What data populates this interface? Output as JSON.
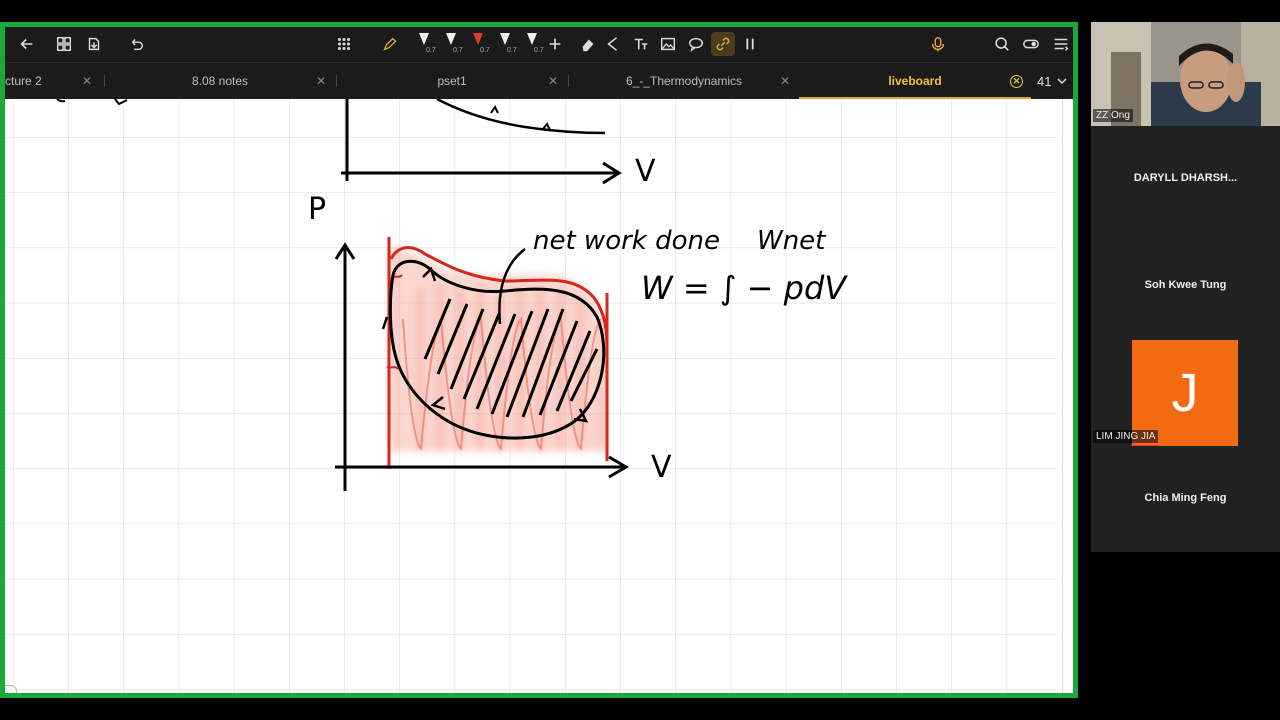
{
  "toolbar": {
    "back": "back-arrow-icon",
    "pens": [
      "0.7",
      "0.7",
      "0.7",
      "0.7",
      "0.7"
    ],
    "icons": [
      "back-arrow-icon",
      "grid-icon",
      "export-icon",
      "undo-icon",
      "apps-grid-icon",
      "pencil-icon",
      "plus-icon",
      "eraser-icon",
      "lasso-icon",
      "text-icon",
      "image-icon",
      "comment-icon",
      "link-icon",
      "pause-icon",
      "microphone-icon",
      "search-icon",
      "toggle-icon",
      "menu-icon"
    ]
  },
  "tabs": [
    {
      "label": "cture 2"
    },
    {
      "label": "8.08 notes"
    },
    {
      "label": "pset1"
    },
    {
      "label": "6_-_Thermodynamics"
    },
    {
      "label": "liveboard",
      "active": true
    }
  ],
  "page_count": "41",
  "whiteboard": {
    "handwriting": {
      "axis_top_v": "V",
      "axis_p": "P",
      "axis_bottom_v": "V",
      "annotation_1": "net work done",
      "annotation_2": "Wnet",
      "equation": "W = ∫ − pdV"
    },
    "colors": {
      "ink": "#000000",
      "red": "#d9261c",
      "grid": "#d7d7d7"
    }
  },
  "participants": [
    {
      "name": "ZZ Ong",
      "type": "video"
    },
    {
      "name": "DARYLL DHARSH..."
    },
    {
      "name": "Soh Kwee Tung"
    },
    {
      "name": "LIM JING JIA",
      "avatar_letter": "J",
      "avatar_color": "#f26a12"
    },
    {
      "name": "Chia Ming Feng"
    }
  ]
}
